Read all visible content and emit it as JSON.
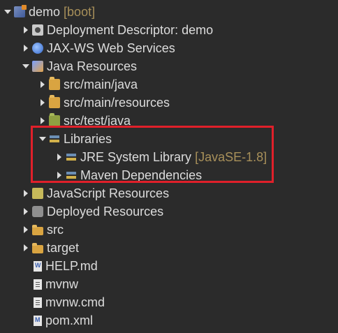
{
  "colors": {
    "background": "#2b2b2b",
    "text": "#dcdcdc",
    "decoration": "#a8905a",
    "highlight": "#e0202a"
  },
  "tree": [
    {
      "id": "demo",
      "label": "demo",
      "decoration": "[boot]",
      "icon": "project-icon"
    },
    {
      "id": "dd",
      "label": "Deployment Descriptor: demo",
      "icon": "deployment-descriptor-icon"
    },
    {
      "id": "jaxws",
      "label": "JAX-WS Web Services",
      "icon": "web-services-icon"
    },
    {
      "id": "jr",
      "label": "Java Resources",
      "icon": "java-resources-icon"
    },
    {
      "id": "srcmainjava",
      "label": "src/main/java",
      "icon": "source-folder-icon"
    },
    {
      "id": "srcmainres",
      "label": "src/main/resources",
      "icon": "source-folder-icon"
    },
    {
      "id": "srctest",
      "label": "src/test/java",
      "icon": "test-source-folder-icon"
    },
    {
      "id": "libs",
      "label": "Libraries",
      "icon": "libraries-icon"
    },
    {
      "id": "jre",
      "label": "JRE System Library",
      "decoration": "[JavaSE-1.8]",
      "icon": "library-icon"
    },
    {
      "id": "maven",
      "label": "Maven Dependencies",
      "icon": "library-icon"
    },
    {
      "id": "jsres",
      "label": "JavaScript Resources",
      "icon": "javascript-resources-icon"
    },
    {
      "id": "deployed",
      "label": "Deployed Resources",
      "icon": "deployed-resources-icon"
    },
    {
      "id": "src",
      "label": "src",
      "icon": "folder-icon"
    },
    {
      "id": "target",
      "label": "target",
      "icon": "folder-icon"
    },
    {
      "id": "help",
      "label": "HELP.md",
      "icon": "markdown-file-icon"
    },
    {
      "id": "mvnw",
      "label": "mvnw",
      "icon": "file-icon"
    },
    {
      "id": "mvnwcmd",
      "label": "mvnw.cmd",
      "icon": "file-icon"
    },
    {
      "id": "pom",
      "label": "pom.xml",
      "icon": "xml-file-icon"
    }
  ]
}
